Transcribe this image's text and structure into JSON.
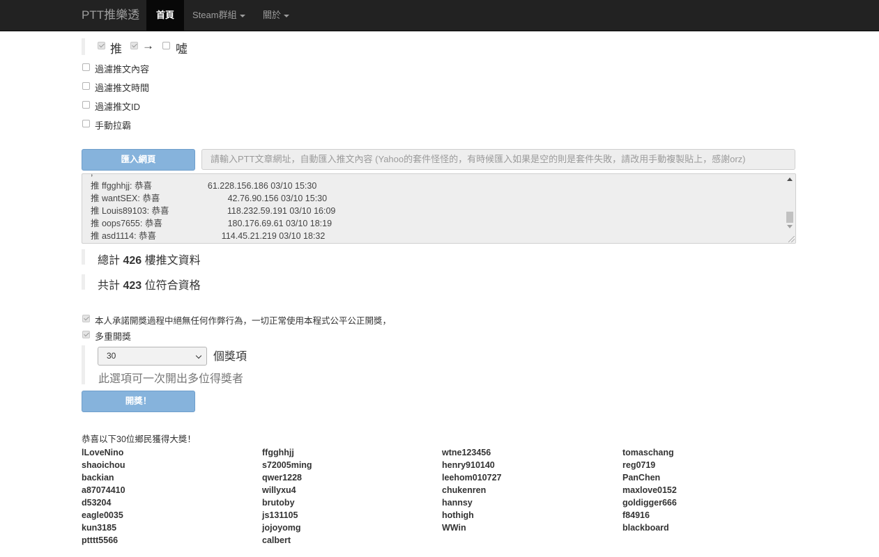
{
  "navbar": {
    "brand": "PTT推樂透",
    "items": [
      {
        "label": "首頁",
        "active": true
      },
      {
        "label": "Steam群組",
        "dropdown": true
      },
      {
        "label": "關於",
        "dropdown": true
      }
    ]
  },
  "push_types": {
    "push": "推",
    "arrow": "→",
    "boo": "噓",
    "push_checked": true,
    "arrow_checked": true,
    "boo_checked": false
  },
  "filters": [
    {
      "label": "過濾推文內容",
      "checked": false
    },
    {
      "label": "過濾推文時間",
      "checked": false
    },
    {
      "label": "過濾推文ID",
      "checked": false
    },
    {
      "label": "手動拉霸",
      "checked": false
    }
  ],
  "import": {
    "button": "匯入網頁",
    "placeholder": "請輸入PTT文章網址，自動匯入推文內容 (Yahoo的套件怪怪的，有時候匯入如果是空的則是套件失敗，請改用手動複製貼上，感謝orz)"
  },
  "comments": [
    "推 ffgghhjj: 恭喜                       61.228.156.186 03/10 15:30",
    "推 wantSEX: 恭喜                            42.76.90.156 03/10 15:30",
    "推 Louis89103: 恭喜                        118.232.59.191 03/10 16:09",
    "推 oops7655: 恭喜                           180.176.69.61 03/10 18:19",
    "推 asd1114: 恭喜                           114.45.21.219 03/10 18:32"
  ],
  "stats": {
    "total_prefix": "總計",
    "total_count": "426",
    "total_suffix": "樓推文資料",
    "qualified_prefix": "共計",
    "qualified_count": "423",
    "qualified_suffix": "位符合資格"
  },
  "pledge": {
    "label": "本人承諾開獎過程中絕無任何作弊行為，一切正常使用本程式公平公正開獎，",
    "checked": true
  },
  "multi": {
    "label": "多重開獎",
    "checked": true
  },
  "prize_count": {
    "selected": "30",
    "suffix": "個獎項",
    "help": "此選項可一次開出多位得獎者"
  },
  "draw_button": "開獎！",
  "winners_heading": "恭喜以下30位鄉民獲得大獎！",
  "winners": [
    [
      "lLoveNino",
      "shaoichou",
      "backian",
      "a87074410",
      "d53204",
      "eagle0035",
      "kun3185",
      "ptttt5566"
    ],
    [
      "ffgghhjj",
      "s72005ming",
      "qwer1228",
      "willyxu4",
      "brutoby",
      "js131105",
      "jojoyomg",
      "calbert"
    ],
    [
      "wtne123456",
      "henry910140",
      "leehom010727",
      "chukenren",
      "hannsy",
      "hothigh",
      "WWin"
    ],
    [
      "tomaschang",
      "reg0719",
      "PanChen",
      "maxlove0152",
      "goldigger666",
      "f84916",
      "blackboard"
    ]
  ]
}
